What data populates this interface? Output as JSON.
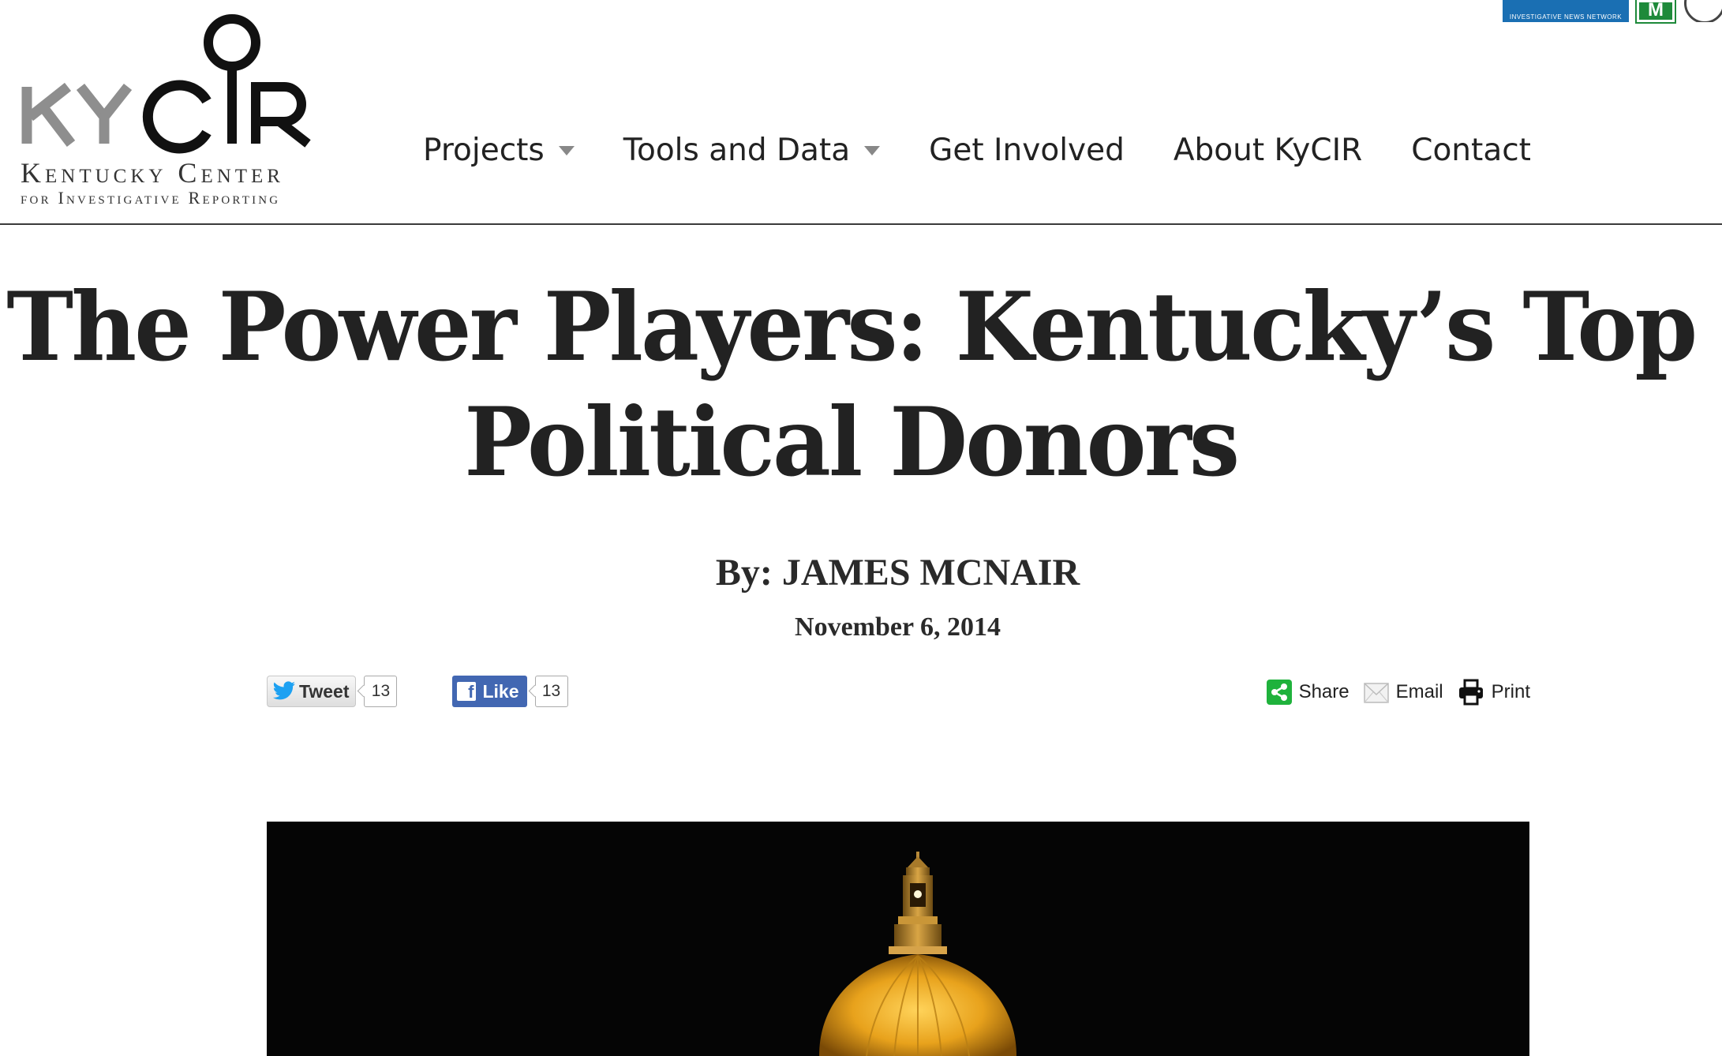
{
  "logo": {
    "wordmark": "KYCIR",
    "line1": "Kentucky Center",
    "line2": "for Investigative Reporting"
  },
  "partners": {
    "inn": "INVESTIGATIVE NEWS NETWORK",
    "m": "M"
  },
  "nav": {
    "items": [
      {
        "label": "Projects",
        "has_dropdown": true
      },
      {
        "label": "Tools and Data",
        "has_dropdown": true
      },
      {
        "label": "Get Involved",
        "has_dropdown": false
      },
      {
        "label": "About KyCIR",
        "has_dropdown": false
      },
      {
        "label": "Contact",
        "has_dropdown": false
      }
    ]
  },
  "article": {
    "title_line1": "The Power Players: Kentucky’s Top",
    "title_line2": "Political Donors",
    "byline": "By: JAMES MCNAIR",
    "date": "November 6, 2014"
  },
  "social": {
    "tweet_label": "Tweet",
    "tweet_count": "13",
    "like_label": "Like",
    "like_count": "13",
    "share_label": "Share",
    "email_label": "Email",
    "print_label": "Print"
  },
  "colors": {
    "facebook": "#4267b2",
    "twitter": "#1da1f2",
    "share_green": "#1fb23c",
    "dome_gold": "#e8a21c"
  },
  "icons": [
    "twitter-bird-icon",
    "facebook-f-icon",
    "share-icon",
    "envelope-icon",
    "printer-icon",
    "dropdown-caret-icon"
  ]
}
